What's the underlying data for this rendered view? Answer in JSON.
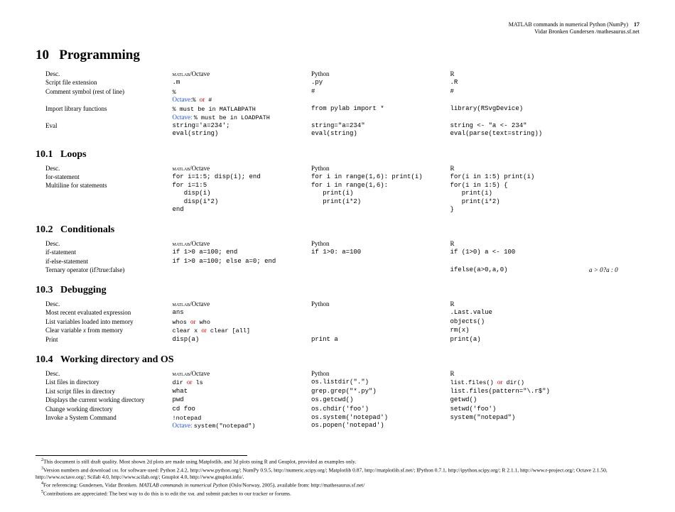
{
  "header": {
    "title": "MATLAB commands in numerical Python (NumPy)",
    "page": "17",
    "author": "Vidar Bronken Gundersen /mathesaurus.sf.net"
  },
  "sections": {
    "s10": {
      "num": "10",
      "title": "Programming"
    },
    "s101": {
      "num": "10.1",
      "title": "Loops"
    },
    "s102": {
      "num": "10.2",
      "title": "Conditionals"
    },
    "s103": {
      "num": "10.3",
      "title": "Debugging"
    },
    "s104": {
      "num": "10.4",
      "title": "Working directory and OS"
    }
  },
  "colheads": {
    "desc": "Desc.",
    "matlab_pre": "matlab",
    "matlab_post": "/Octave",
    "python": "Python",
    "r": "R"
  },
  "kw": {
    "octave": "Octave:",
    "or": "or"
  },
  "t10": {
    "r1": {
      "d": "Script file extension",
      "m": ".m",
      "p": ".py",
      "r": ".R"
    },
    "r2": {
      "d": "Comment symbol (rest of line)",
      "m": "%",
      "p": "#",
      "r": "#",
      "m2a": "% ",
      "m2b": " #"
    },
    "r3": {
      "d": "Import library functions",
      "m": "% must be in MATLABPATH",
      "m2": "% must be in LOADPATH",
      "p": "from pylab import *",
      "r": "library(RSvgDevice)"
    },
    "r4": {
      "d": "Eval",
      "m": "string='a=234';\neval(string)",
      "p": "string=\"a=234\"\neval(string)",
      "r": "string <- \"a <- 234\"\neval(parse(text=string))"
    }
  },
  "t101": {
    "r1": {
      "d": "for-statement",
      "m": "for i=1:5; disp(i); end",
      "p": "for i in range(1,6): print(i)",
      "r": "for(i in 1:5) print(i)"
    },
    "r2": {
      "d": "Multiline for statements",
      "m": "for i=1:5\n   disp(i)\n   disp(i*2)\nend",
      "p": "for i in range(1,6):\n   print(i)\n   print(i*2)",
      "r": "for(i in 1:5) {\n   print(i)\n   print(i*2)\n}"
    }
  },
  "t102": {
    "r1": {
      "d": "if-statement",
      "m": "if 1>0 a=100; end",
      "p": "if 1>0: a=100",
      "r": "if (1>0) a <- 100"
    },
    "r2": {
      "d": "if-else-statement",
      "m": "if 1>0 a=100; else a=0; end"
    },
    "r3": {
      "d": "Ternary operator (if?true:false)",
      "r": "ifelse(a>0,a,0)",
      "ex": "a > 0?a : 0"
    }
  },
  "t103": {
    "r1": {
      "d": "Most recent evaluated expression",
      "m": "ans",
      "r": ".Last.value"
    },
    "r2": {
      "d": "List variables loaded into memory",
      "m1": "whos ",
      "m2": " who",
      "r": "objects()"
    },
    "r3a": "Clear variable ",
    "r3b": " from memory",
    "r3x": "x",
    "r3": {
      "m1": "clear x ",
      "m2": " clear [all]",
      "r": "rm(x)"
    },
    "r4": {
      "d": "Print",
      "m": "disp(a)",
      "p": "print a",
      "r": "print(a)"
    }
  },
  "t104": {
    "r1": {
      "d": "List files in directory",
      "m1": "dir ",
      "m2": " ls",
      "p": "os.listdir(\".\")",
      "r1": "list.files() ",
      "r2": " dir()"
    },
    "r2": {
      "d": "List script files in directory",
      "m": "what",
      "p": "grep.grep(\"*.py\")",
      "r": "list.files(pattern=\"\\.r$\")"
    },
    "r3": {
      "d": "Displays the current working directory",
      "m": "pwd",
      "p": "os.getcwd()",
      "r": "getwd()"
    },
    "r4": {
      "d": "Change working directory",
      "m": "cd foo",
      "p": "os.chdir('foo')",
      "r": "setwd('foo')"
    },
    "r5": {
      "d": "Invoke a System Command",
      "m": "!notepad",
      "m2": "system(\"notepad\")",
      "p": "os.system('notepad')\nos.popen('notepad')",
      "r": "system(\"notepad\")"
    }
  },
  "footnotes": {
    "f2": "This document is still draft quality. Most shown 2d plots are made using Matplotlib, and 3d plots using R and Gnuplot, provided as examples only.",
    "f3a": "Version numbers and download ",
    "f3url": "url",
    "f3b": " for software used: Python 2.4.2, http://www.python.org/; NumPy 0.9.5, http://numeric.scipy.org/; Matplotlib 0.87, http://matplotlib.sf.net/; IPython 0.7.1, http://ipython.scipy.org/; R 2.1.1, http://www.r-project.org/; Octave 2.1.50, http://www.octave.org/; Scilab 4.0, http://www.scilab.org/; Gnuplot 4.0, http://www.gnuplot.info/.",
    "f4a": "For referencing: Gundersen, Vidar Bronken. ",
    "f4i": "MATLAB commands in numerical Python",
    "f4b": " (Oslo/Norway, 2005), available from: http://mathesaurus.sf.net/",
    "f5a": "Contributions are appreciated: The best way to do this is to edit the ",
    "f5x": "xml",
    "f5b": " and submit patches to our tracker or forums."
  }
}
